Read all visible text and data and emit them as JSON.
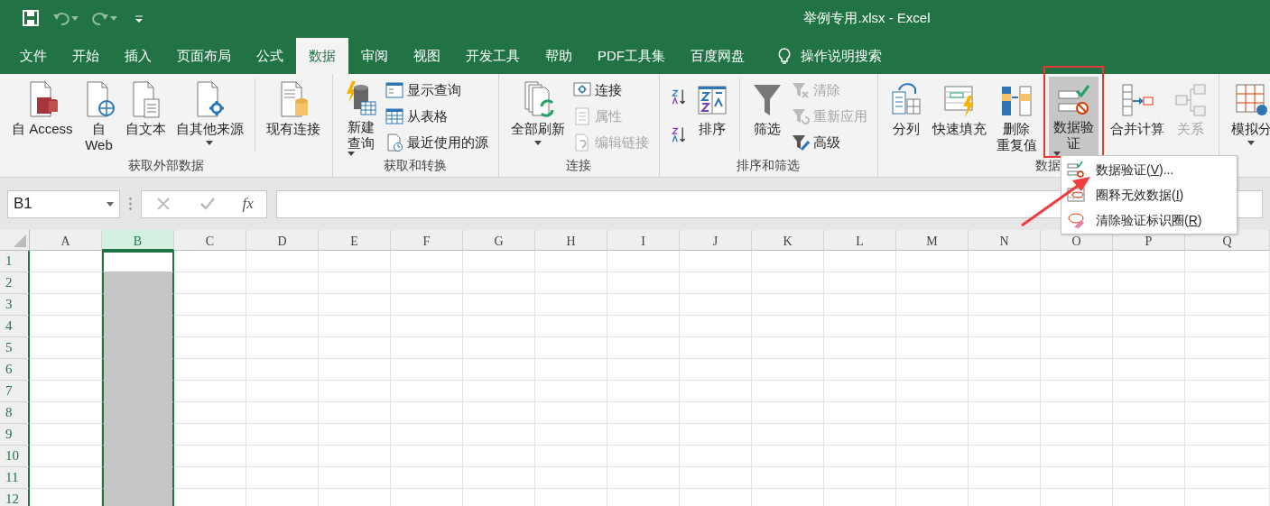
{
  "window": {
    "title": "举例专用.xlsx - Excel"
  },
  "quick_access": [
    {
      "kind": "save",
      "disabled": false,
      "dropdown": false
    },
    {
      "kind": "undo",
      "disabled": true,
      "dropdown": true
    },
    {
      "kind": "redo",
      "disabled": true,
      "dropdown": true
    },
    {
      "kind": "customize",
      "disabled": false,
      "dropdown": false
    }
  ],
  "tabs": [
    {
      "label": "文件",
      "selected": false
    },
    {
      "label": "开始",
      "selected": false
    },
    {
      "label": "插入",
      "selected": false
    },
    {
      "label": "页面布局",
      "selected": false
    },
    {
      "label": "公式",
      "selected": false
    },
    {
      "label": "数据",
      "selected": true
    },
    {
      "label": "审阅",
      "selected": false
    },
    {
      "label": "视图",
      "selected": false
    },
    {
      "label": "开发工具",
      "selected": false
    },
    {
      "label": "帮助",
      "selected": false
    },
    {
      "label": "PDF工具集",
      "selected": false
    },
    {
      "label": "百度网盘",
      "selected": false
    }
  ],
  "tell_me": {
    "label": "操作说明搜索"
  },
  "ribbon": {
    "groups": [
      {
        "label": "获取外部数据",
        "items": [
          {
            "kind": "large",
            "lines": [
              "自 Access"
            ],
            "dropdown": false,
            "disabled": false
          },
          {
            "kind": "large",
            "lines": [
              "自",
              "Web"
            ],
            "dropdown": false,
            "disabled": false
          },
          {
            "kind": "large",
            "lines": [
              "自文本"
            ],
            "dropdown": false,
            "disabled": false
          },
          {
            "kind": "large",
            "lines": [
              "自其他来源"
            ],
            "dropdown": true,
            "disabled": false
          },
          {
            "kind": "separator"
          },
          {
            "kind": "large",
            "lines": [
              "现有连接"
            ],
            "dropdown": false,
            "disabled": false
          }
        ]
      },
      {
        "label": "获取和转换",
        "items": [
          {
            "kind": "large",
            "lines": [
              "新建",
              "查询"
            ],
            "dropdown": true,
            "disabled": false
          },
          {
            "kind": "stack",
            "items": [
              {
                "label": "显示查询",
                "disabled": false
              },
              {
                "label": "从表格",
                "disabled": false
              },
              {
                "label": "最近使用的源",
                "disabled": false
              }
            ]
          }
        ]
      },
      {
        "label": "连接",
        "items": [
          {
            "kind": "large",
            "lines": [
              "全部刷新"
            ],
            "dropdown": true,
            "disabled": false
          },
          {
            "kind": "stack",
            "items": [
              {
                "label": "连接",
                "disabled": false
              },
              {
                "label": "属性",
                "disabled": true
              },
              {
                "label": "编辑链接",
                "disabled": true
              }
            ]
          }
        ]
      },
      {
        "label": "排序和筛选",
        "items": [
          {
            "kind": "sort_stack"
          },
          {
            "kind": "large",
            "lines": [
              "排序"
            ],
            "dropdown": false,
            "disabled": false
          },
          {
            "kind": "separator"
          },
          {
            "kind": "large",
            "lines": [
              "筛选"
            ],
            "dropdown": false,
            "disabled": false
          },
          {
            "kind": "stack",
            "items": [
              {
                "label": "清除",
                "disabled": true
              },
              {
                "label": "重新应用",
                "disabled": true
              },
              {
                "label": "高级",
                "disabled": false
              }
            ]
          }
        ]
      },
      {
        "label": "数据",
        "items": [
          {
            "kind": "large",
            "lines": [
              "分列"
            ],
            "dropdown": false,
            "disabled": false
          },
          {
            "kind": "large",
            "lines": [
              "快速填充"
            ],
            "dropdown": false,
            "disabled": false
          },
          {
            "kind": "large",
            "lines": [
              "删除",
              "重复值"
            ],
            "dropdown": false,
            "disabled": false
          },
          {
            "kind": "large",
            "lines": [
              "数据验",
              "证"
            ],
            "dropdown": true,
            "disabled": false,
            "pressed": true,
            "highlighted": true
          },
          {
            "kind": "large",
            "lines": [
              "合并计算"
            ],
            "dropdown": false,
            "disabled": false
          },
          {
            "kind": "large",
            "lines": [
              "关系"
            ],
            "dropdown": false,
            "disabled": true
          }
        ]
      },
      {
        "items": [
          {
            "kind": "large",
            "lines": [
              "模拟分"
            ],
            "dropdown": true,
            "disabled": false
          }
        ]
      }
    ]
  },
  "dropdown_menu": {
    "items": [
      {
        "before": "数据验证(",
        "key": "V",
        "after": ")..."
      },
      {
        "before": "圈释无效数据(",
        "key": "I",
        "after": ")"
      },
      {
        "before": "清除验证标识圈(",
        "key": "R",
        "after": ")"
      }
    ]
  },
  "formula_bar": {
    "name_box": "B1",
    "function_label": "fx"
  },
  "grid": {
    "columns": [
      {
        "label": "A",
        "selected": false
      },
      {
        "label": "B",
        "selected": true
      },
      {
        "label": "C",
        "selected": false
      },
      {
        "label": "D",
        "selected": false
      },
      {
        "label": "E",
        "selected": false
      },
      {
        "label": "F",
        "selected": false
      },
      {
        "label": "G",
        "selected": false
      },
      {
        "label": "H",
        "selected": false
      },
      {
        "label": "I",
        "selected": false
      },
      {
        "label": "J",
        "selected": false
      },
      {
        "label": "K",
        "selected": false
      },
      {
        "label": "L",
        "selected": false
      },
      {
        "label": "M",
        "selected": false
      },
      {
        "label": "N",
        "selected": false
      },
      {
        "label": "O",
        "selected": false
      },
      {
        "label": "P",
        "selected": false
      },
      {
        "label": "Q",
        "selected": false
      }
    ],
    "rows": [
      {
        "label": "1",
        "selected": true
      },
      {
        "label": "2",
        "selected": true
      },
      {
        "label": "3",
        "selected": true
      },
      {
        "label": "4",
        "selected": true
      },
      {
        "label": "5",
        "selected": true
      },
      {
        "label": "6",
        "selected": true
      },
      {
        "label": "7",
        "selected": true
      },
      {
        "label": "8",
        "selected": true
      },
      {
        "label": "9",
        "selected": true
      },
      {
        "label": "10",
        "selected": true
      },
      {
        "label": "11",
        "selected": true
      },
      {
        "label": "12",
        "selected": true
      }
    ]
  }
}
